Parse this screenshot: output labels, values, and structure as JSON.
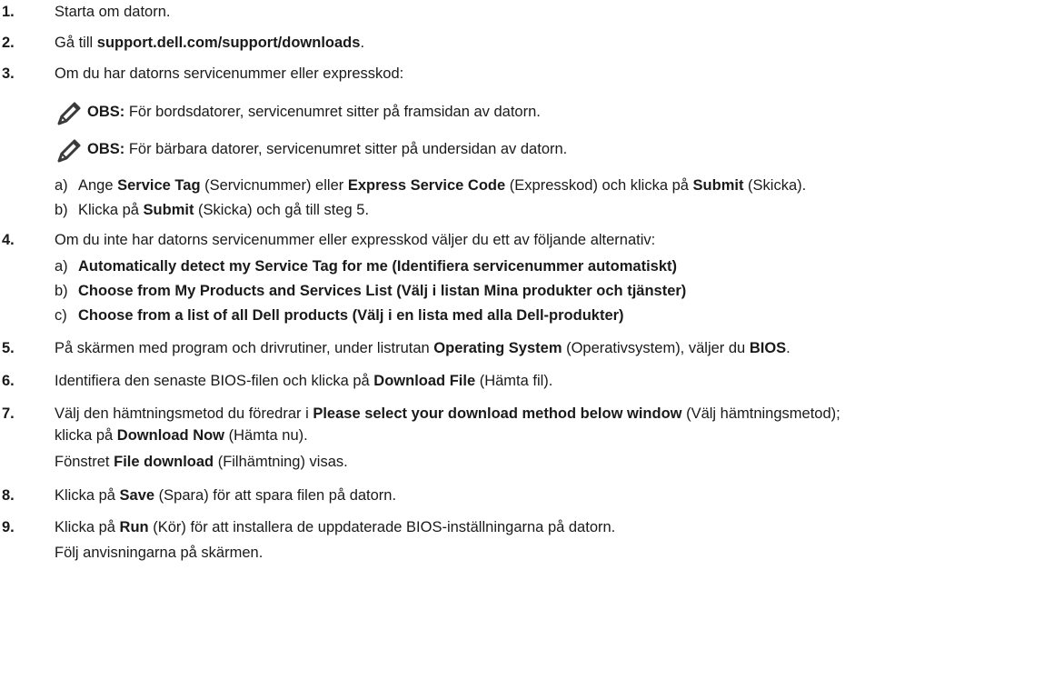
{
  "steps": [
    {
      "num": "1.",
      "parts": [
        {
          "t": "Starta om datorn.",
          "b": false
        }
      ]
    },
    {
      "num": "2.",
      "parts": [
        {
          "t": "Gå till ",
          "b": false
        },
        {
          "t": "support.dell.com/support/downloads",
          "b": true
        },
        {
          "t": ".",
          "b": false
        }
      ]
    },
    {
      "num": "3.",
      "parts": [
        {
          "t": "Om du har datorns servicenummer eller expresskod:",
          "b": false
        }
      ]
    },
    {
      "num": "4.",
      "parts": [
        {
          "t": "Om du inte har datorns servicenummer eller expresskod väljer du ett av följande alternativ:",
          "b": false
        }
      ]
    },
    {
      "num": "5.",
      "parts": [
        {
          "t": "På skärmen med program och drivrutiner, under listrutan ",
          "b": false
        },
        {
          "t": "Operating System",
          "b": true
        },
        {
          "t": " (Operativsystem), väljer du ",
          "b": false
        },
        {
          "t": "BIOS",
          "b": true
        },
        {
          "t": ".",
          "b": false
        }
      ]
    },
    {
      "num": "6.",
      "parts": [
        {
          "t": "Identifiera den senaste BIOS-filen och klicka på ",
          "b": false
        },
        {
          "t": "Download File",
          "b": true
        },
        {
          "t": " (Hämta fil).",
          "b": false
        }
      ]
    },
    {
      "num": "7.",
      "parts": [
        {
          "t": "Välj den hämtningsmetod du föredrar i ",
          "b": false
        },
        {
          "t": "Please select your download method below window",
          "b": true
        },
        {
          "t": " (Välj hämtningsmetod);",
          "b": false
        }
      ]
    },
    {
      "num": "8.",
      "parts": [
        {
          "t": "Klicka på ",
          "b": false
        },
        {
          "t": "Save",
          "b": true
        },
        {
          "t": " (Spara) för att spara filen på datorn.",
          "b": false
        }
      ]
    },
    {
      "num": "9.",
      "parts": [
        {
          "t": "Klicka på ",
          "b": false
        },
        {
          "t": "Run",
          "b": true
        },
        {
          "t": " (Kör) för att installera de uppdaterade BIOS-inställningarna på datorn.",
          "b": false
        }
      ]
    }
  ],
  "step7_line2": [
    {
      "t": "klicka på ",
      "b": false
    },
    {
      "t": "Download Now",
      "b": true
    },
    {
      "t": " (Hämta nu).",
      "b": false
    }
  ],
  "step7_line3": [
    {
      "t": "Fönstret ",
      "b": false
    },
    {
      "t": "File download",
      "b": true
    },
    {
      "t": " (Filhämtning) visas.",
      "b": false
    }
  ],
  "step9_line2": [
    {
      "t": "Följ anvisningarna på skärmen.",
      "b": false
    }
  ],
  "notes": [
    {
      "label": "OBS:",
      "text": " För bordsdatorer, servicenumret sitter på framsidan av datorn."
    },
    {
      "label": "OBS:",
      "text": " För bärbara datorer, servicenumret sitter på undersidan av datorn."
    }
  ],
  "step3_sub": [
    {
      "letter": "a)",
      "parts": [
        {
          "t": "Ange ",
          "b": false
        },
        {
          "t": "Service Tag",
          "b": true
        },
        {
          "t": " (Servicnummer) eller ",
          "b": false
        },
        {
          "t": "Express Service Code",
          "b": true
        },
        {
          "t": " (Expresskod) och klicka på ",
          "b": false
        },
        {
          "t": "Submit",
          "b": true
        },
        {
          "t": " (Skicka).",
          "b": false
        }
      ]
    },
    {
      "letter": "b)",
      "parts": [
        {
          "t": "Klicka på ",
          "b": false
        },
        {
          "t": "Submit",
          "b": true
        },
        {
          "t": " (Skicka) och gå till steg 5.",
          "b": false
        }
      ]
    }
  ],
  "step4_sub": [
    {
      "letter": "a)",
      "parts": [
        {
          "t": "Automatically detect my Service Tag for me (Identifiera servicenummer automatiskt)",
          "b": true
        }
      ]
    },
    {
      "letter": "b)",
      "parts": [
        {
          "t": "Choose from My Products and Services List (Välj i listan Mina produkter och tjänster)",
          "b": true
        }
      ]
    },
    {
      "letter": "c)",
      "parts": [
        {
          "t": "Choose from a list of all Dell products (Välj i en lista med alla Dell-produkter)",
          "b": true
        }
      ]
    }
  ]
}
